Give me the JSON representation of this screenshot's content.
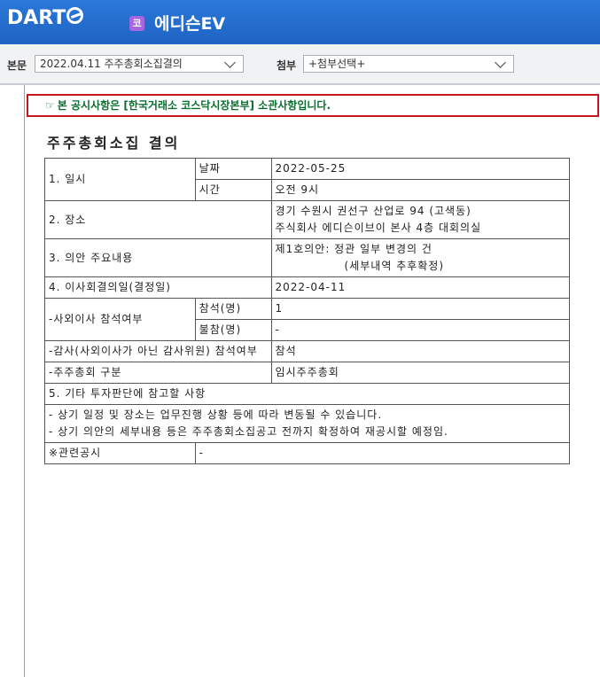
{
  "header": {
    "logo_text": "DART",
    "company_badge": "코",
    "company_name": "에디슨EV"
  },
  "toolbar": {
    "main_label": "본문",
    "main_select_value": "2022.04.11  주주총회소집결의",
    "attach_label": "첨부",
    "attach_select_value": "+첨부선택+"
  },
  "notice": {
    "icon": "☞",
    "text": "본 공시사항은 [한국거래소 코스닥시장본부] 소관사항입니다."
  },
  "document": {
    "title": "주주총회소집 결의",
    "rows": {
      "date_label": "1. 일시",
      "date_sub": "날짜",
      "date_value": "2022-05-25",
      "time_sub": "시간",
      "time_value": "오전 9시",
      "place_label": "2. 장소",
      "place_line1": "경기 수원시 권선구 산업로 94 (고색동)",
      "place_line2": "주식회사 에디슨이브이 본사 4층 대회의실",
      "agenda_label": "3. 의안 주요내용",
      "agenda_line1": "제1호의안: 정관 일부 변경의 건",
      "agenda_line2": "(세부내역 추후확정)",
      "board_label": "4. 이사회결의일(결정일)",
      "board_value": "2022-04-11",
      "outside_label": "-사외이사 참석여부",
      "outside_attend_sub": "참석(명)",
      "outside_attend_value": "1",
      "outside_absent_sub": "불참(명)",
      "outside_absent_value": "-",
      "auditor_label": "-감사(사외이사가 아닌 감사위원) 참석여부",
      "auditor_value": "참석",
      "meeting_type_label": "-주주총회 구분",
      "meeting_type_value": "임시주주총회",
      "other_label": "5. 기타 투자판단에 참고할 사항",
      "other_line1": "- 상기 일정 및 장소는 업무진행 상황 등에 따라 변동될 수 있습니다.",
      "other_line2": "- 상기 의안의 세부내용 등은 주주총회소집공고 전까지 확정하여 재공시할 예정임.",
      "related_label": "※관련공시",
      "related_value": "-"
    }
  }
}
